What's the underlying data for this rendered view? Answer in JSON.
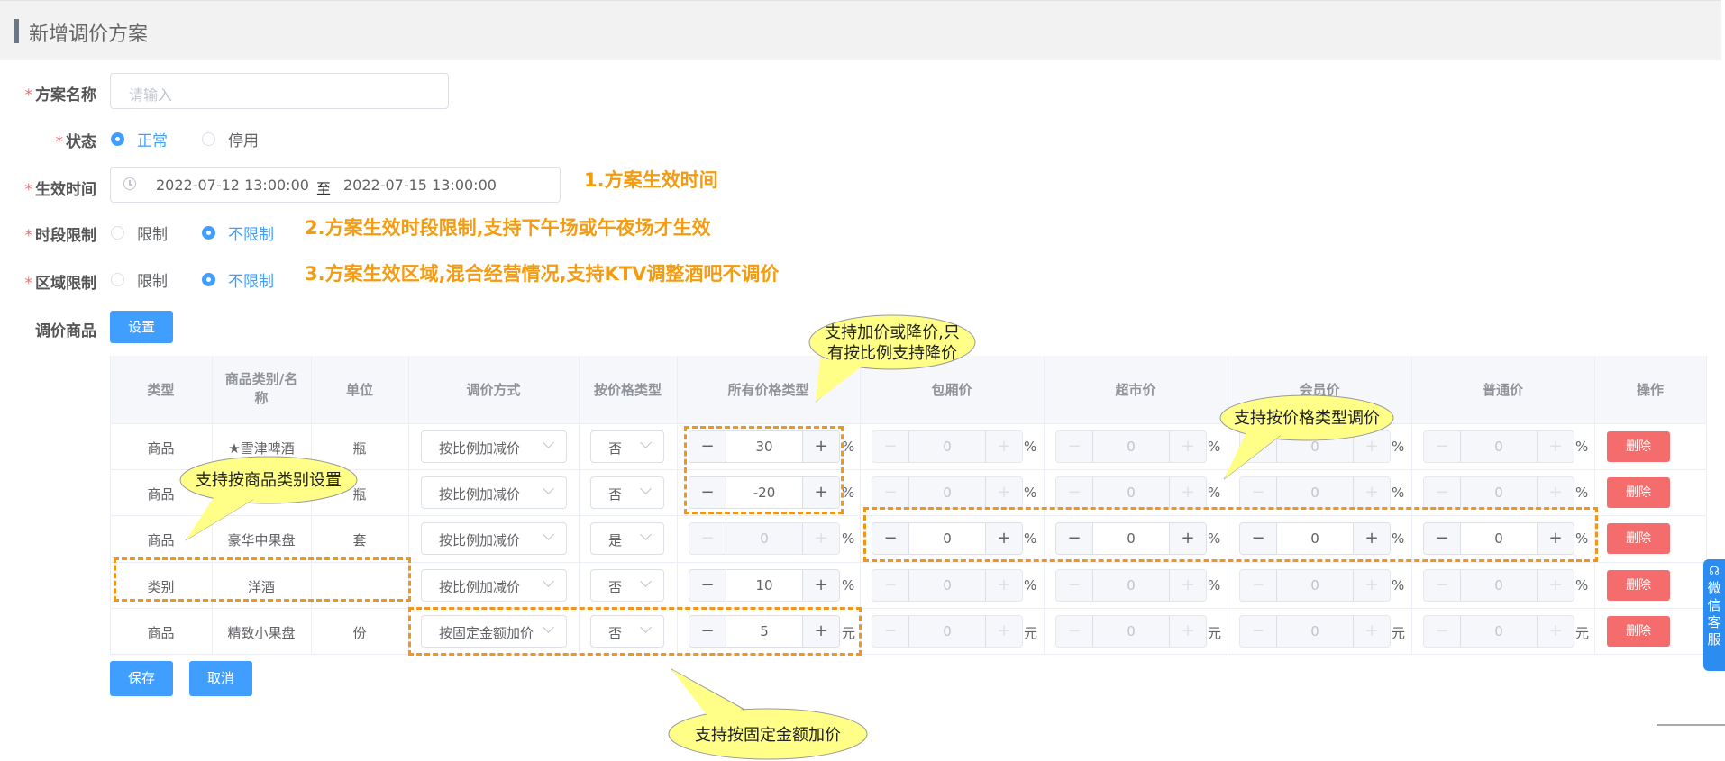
{
  "page": {
    "title": "新增调价方案"
  },
  "form": {
    "name": {
      "label": "方案名称",
      "placeholder": "请输入"
    },
    "status": {
      "label": "状态",
      "options": [
        "正常",
        "停用"
      ],
      "selected": "正常"
    },
    "effective": {
      "label": "生效时间",
      "start": "2022-07-12 13:00:00",
      "separator": "至",
      "end": "2022-07-15 13:00:00"
    },
    "period": {
      "label": "时段限制",
      "options": [
        "限制",
        "不限制"
      ],
      "selected": "不限制"
    },
    "area": {
      "label": "区域限制",
      "options": [
        "限制",
        "不限制"
      ],
      "selected": "不限制"
    },
    "goods": {
      "label": "调价商品",
      "set_button": "设置"
    }
  },
  "annotations": {
    "a1": "1.方案生效时间",
    "a2": "2.方案生效时段限制,支持下午场或午夜场才生效",
    "a3": "3.方案生效区域,混合经营情况,支持KTV调整酒吧不调价"
  },
  "callouts": {
    "c1_line1": "支持加价或降价,只",
    "c1_line2": "有按比例支持降价",
    "c2": "支持按价格类型调价",
    "c3": "支持按商品类别设置",
    "c4": "支持按固定金额加价"
  },
  "table": {
    "headers": {
      "type": "类型",
      "name_line1": "商品类别/名",
      "name_line2": "称",
      "unit": "单位",
      "method": "调价方式",
      "by_price_type": "按价格类型",
      "all_price": "所有价格类型",
      "room": "包厢价",
      "market": "超市价",
      "member": "会员价",
      "normal": "普通价",
      "ops": "操作"
    },
    "rows": [
      {
        "type": "商品",
        "name": "★雪津啤酒",
        "unit": "瓶",
        "method": "按比例加减价",
        "by_type": "否",
        "all": "30",
        "room": "0",
        "market": "0",
        "member": "0",
        "normal": "0",
        "u": "%",
        "del": "删除"
      },
      {
        "type": "商品",
        "name": "",
        "unit": "瓶",
        "method": "按比例加减价",
        "by_type": "否",
        "all": "-20",
        "room": "0",
        "market": "0",
        "member": "0",
        "normal": "0",
        "u": "%",
        "del": "删除"
      },
      {
        "type": "商品",
        "name": "豪华中果盘",
        "unit": "套",
        "method": "按比例加减价",
        "by_type": "是",
        "all": "0",
        "room": "0",
        "market": "0",
        "member": "0",
        "normal": "0",
        "u": "%",
        "del": "删除"
      },
      {
        "type": "类别",
        "name": "洋酒",
        "unit": "",
        "method": "按比例加减价",
        "by_type": "否",
        "all": "10",
        "room": "0",
        "market": "0",
        "member": "0",
        "normal": "0",
        "u": "%",
        "del": "删除"
      },
      {
        "type": "商品",
        "name": "精致小果盘",
        "unit": "份",
        "method": "按固定金额加价",
        "by_type": "否",
        "all": "5",
        "room": "0",
        "market": "0",
        "member": "0",
        "normal": "0",
        "u": "元",
        "del": "删除"
      }
    ]
  },
  "actions": {
    "save": "保存",
    "cancel": "取消"
  },
  "side_widget": {
    "text": "微信客服"
  },
  "colors": {
    "primary": "#409eff",
    "danger": "#f56c6c",
    "annotation": "#f39c12",
    "callout": "#ffff88"
  }
}
